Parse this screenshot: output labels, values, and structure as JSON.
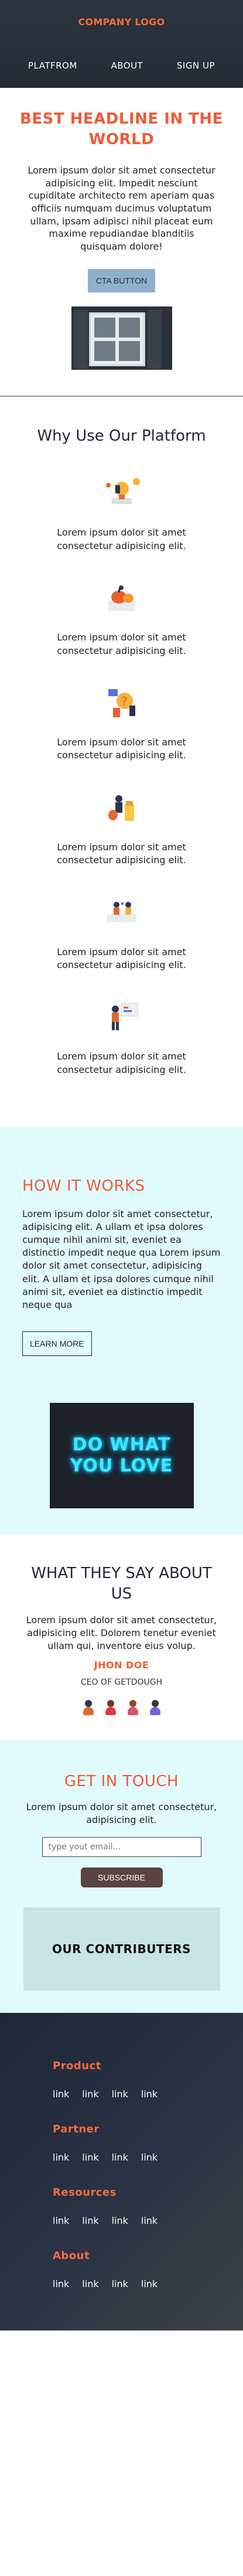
{
  "header": {
    "logo": "COMPANY LOGO",
    "nav": [
      "PLATFROM",
      "ABOUT",
      "SIGN UP"
    ]
  },
  "hero": {
    "title": "BEST HEADLINE IN THE WORLD",
    "text": "Lorem ipsum dolor sit amet consectetur adipisicing elit. Impedit nesciunt cupiditate architecto rem aperiam quas officiis numquam ducimus voluptatum ullam, ipsam adipisci nihil placeat eum maxime repudiandae blanditiis quisquam dolore!",
    "cta": "CTA BUTTON"
  },
  "why": {
    "title": "Why Use Our Platform",
    "features": [
      {
        "icon": "lightbulb-idea-icon",
        "text": "Lorem ipsum dolor sit amet consectetur adipisicing elit."
      },
      {
        "icon": "pumpkin-illustration-icon",
        "text": "Lorem ipsum dolor sit amet consectetur adipisicing elit."
      },
      {
        "icon": "question-mark-illustration-icon",
        "text": "Lorem ipsum dolor sit amet consectetur adipisicing elit."
      },
      {
        "icon": "money-bag-illustration-icon",
        "text": "Lorem ipsum dolor sit amet consectetur adipisicing elit."
      },
      {
        "icon": "team-meeting-illustration-icon",
        "text": "Lorem ipsum dolor sit amet consectetur adipisicing elit."
      },
      {
        "icon": "presentation-illustration-icon",
        "text": "Lorem ipsum dolor sit amet consectetur adipisicing elit."
      }
    ]
  },
  "how": {
    "title": "HOW IT WORKS",
    "text": "Lorem ipsum dolor sit amet consectetur, adipisicing elit. A ullam et ipsa dolores cumque nihil animi sit, eveniet ea distinctio impedit neque qua Lorem ipsum dolor sit amet consectetur, adipisicing elit. A ullam et ipsa dolores cumque nihil animi sit, eveniet ea distinctio impedit neque qua",
    "button": "LEARN MORE",
    "neon_line1": "DO WHAT",
    "neon_line2": "YOU LOVE"
  },
  "testimonials": {
    "title": "WHAT THEY SAY ABOUT US",
    "text": "Lorem ipsum dolor sit amet consectetur, adipisicing elit. Dolorem tenetur eveniet ullam qui, inventore eius volup.",
    "name": "JHON DOE",
    "role": "CEO OF GETDOUGH"
  },
  "contact": {
    "title": "GET IN TOUCH",
    "text": "Lorem ipsum dolor sit amet consectetur, adipisicing elit.",
    "email_placeholder": "type yout email...",
    "subscribe": "SUBSCRIBE",
    "contributors": "OUR CONTRIBUTERS"
  },
  "footer": {
    "groups": [
      {
        "title": "Product",
        "links": [
          "link",
          "link",
          "link",
          "link"
        ]
      },
      {
        "title": "Partner",
        "links": [
          "link",
          "link",
          "link",
          "link"
        ]
      },
      {
        "title": "Resources",
        "links": [
          "link",
          "link",
          "link",
          "link"
        ]
      },
      {
        "title": "About",
        "links": [
          "link",
          "link",
          "link",
          "link"
        ]
      }
    ]
  },
  "colors": {
    "accent": "#f05a37",
    "header_bg": "#2b3442",
    "light_section_bg": "#e1fbfc",
    "cta_bg": "#8fb0cc",
    "subscribe_bg": "#5a4342",
    "neon": "#3fe7ff"
  }
}
